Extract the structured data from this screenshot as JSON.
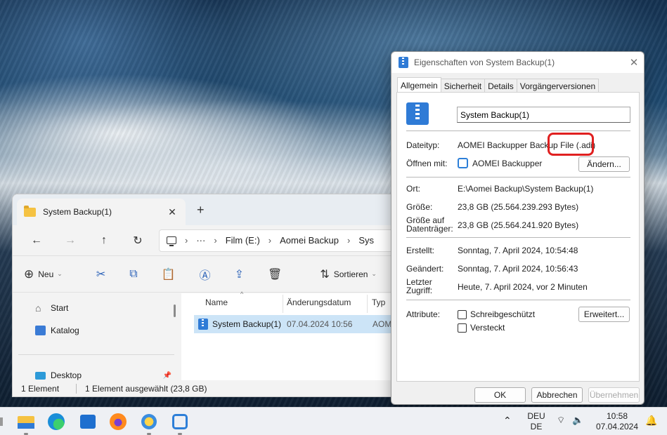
{
  "explorer": {
    "tab_title": "System Backup(1)",
    "tab_close": "✕",
    "new_tab": "+",
    "nav": {
      "back": "←",
      "forward": "→",
      "up": "↑",
      "refresh": "↻",
      "more": "···"
    },
    "breadcrumb": [
      "Film (E:)",
      "Aomei Backup",
      "Sys"
    ],
    "toolbar": {
      "new_label": "Neu",
      "sort_label": "Sortieren"
    },
    "sidebar": {
      "items": [
        {
          "label": "Start"
        },
        {
          "label": "Katalog"
        },
        {
          "label": "Desktop"
        }
      ]
    },
    "columns": {
      "name": "Name",
      "modified": "Änderungsdatum",
      "type": "Typ"
    },
    "file": {
      "name": "System Backup(1)",
      "modified": "07.04.2024 10:56",
      "type": "AOM"
    },
    "status": {
      "count": "1 Element",
      "selected": "1 Element ausgewählt (23,8 GB)"
    }
  },
  "props": {
    "title": "Eigenschaften von System Backup(1)",
    "close": "✕",
    "tabs": [
      "Allgemein",
      "Sicherheit",
      "Details",
      "Vorgängerversionen"
    ],
    "name_value": "System Backup(1)",
    "rows": {
      "filetype_label": "Dateityp:",
      "filetype_value": "AOMEI Backupper Backup File (.adi)",
      "openwith_label": "Öffnen mit:",
      "openwith_value": "AOMEI Backupper",
      "change_button": "Ändern...",
      "location_label": "Ort:",
      "location_value": "E:\\Aomei Backup\\System Backup(1)",
      "size_label": "Größe:",
      "size_value": "23,8 GB (25.564.239.293 Bytes)",
      "disksize_label_1": "Größe auf",
      "disksize_label_2": "Datenträger:",
      "disksize_value": "23,8 GB (25.564.241.920 Bytes)",
      "created_label": "Erstellt:",
      "created_value": "Sonntag, 7. April 2024, 10:54:48",
      "modified_label": "Geändert:",
      "modified_value": "Sonntag, 7. April 2024, 10:56:43",
      "accessed_label_1": "Letzter",
      "accessed_label_2": "Zugriff:",
      "accessed_value": "Heute, 7. April 2024, vor 2 Minuten",
      "attributes_label": "Attribute:",
      "readonly_label": "Schreibgeschützt",
      "hidden_label": "Versteckt",
      "advanced_button": "Erweitert..."
    },
    "buttons": {
      "ok": "OK",
      "cancel": "Abbrechen",
      "apply": "Übernehmen"
    }
  },
  "taskbar": {
    "lang_1": "DEU",
    "lang_2": "DE",
    "time": "10:58",
    "date": "07.04.2024"
  },
  "colors": {
    "accent": "#2f7bd6",
    "highlight": "#e02020",
    "selection": "#cce4f7"
  }
}
